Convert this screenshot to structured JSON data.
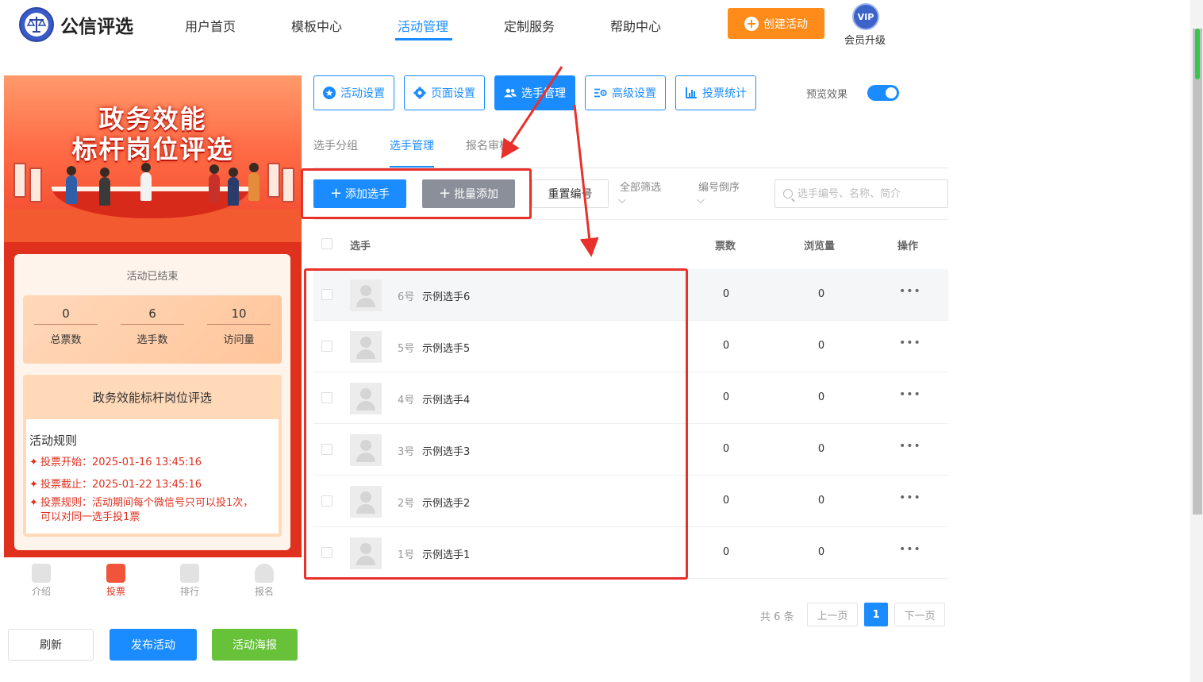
{
  "header": {
    "brand": "公信评选",
    "nav": [
      "用户首页",
      "模板中心",
      "活动管理",
      "定制服务",
      "帮助中心"
    ],
    "active_nav": "活动管理",
    "create_label": "创建活动",
    "vip_badge": "VIP",
    "vip_label": "会员升级"
  },
  "preview": {
    "banner_line1": "政务效能",
    "banner_line2": "标杆岗位评选",
    "status": "活动已结束",
    "stats": [
      {
        "value": "0",
        "label": "总票数"
      },
      {
        "value": "6",
        "label": "选手数"
      },
      {
        "value": "10",
        "label": "访问量"
      }
    ],
    "activity_title": "政务效能标杆岗位评选",
    "rules_heading": "活动规则",
    "rules": [
      "投票开始：2025-01-16 13:45:16",
      "投票截止：2025-01-22 13:45:16",
      "投票规则：活动期间每个微信号只可以投1次，可以对同一选手投1票"
    ],
    "tabs": [
      "介绍",
      "投票",
      "排行",
      "报名"
    ],
    "active_tab": "投票"
  },
  "actions": {
    "refresh": "刷新",
    "publish": "发布活动",
    "poster": "活动海报"
  },
  "toolbar": {
    "items": [
      "活动设置",
      "页面设置",
      "选手管理",
      "高级设置",
      "投票统计"
    ],
    "active": "选手管理",
    "preview_label": "预览效果",
    "preview_on": true
  },
  "subtabs": {
    "items": [
      "选手分组",
      "选手管理",
      "报名审核"
    ],
    "active": "选手管理"
  },
  "controls": {
    "add": "添加选手",
    "batch_add": "批量添加",
    "renumber": "重置编号",
    "filter_all": "全部筛选",
    "sort": "编号倒序",
    "search_placeholder": "选手编号、名称、简介"
  },
  "table": {
    "headers": {
      "player": "选手",
      "votes": "票数",
      "views": "浏览量",
      "ops": "操作"
    },
    "rows": [
      {
        "num": "6号",
        "name": "示例选手6",
        "votes": "0",
        "views": "0"
      },
      {
        "num": "5号",
        "name": "示例选手5",
        "votes": "0",
        "views": "0"
      },
      {
        "num": "4号",
        "name": "示例选手4",
        "votes": "0",
        "views": "0"
      },
      {
        "num": "3号",
        "name": "示例选手3",
        "votes": "0",
        "views": "0"
      },
      {
        "num": "2号",
        "name": "示例选手2",
        "votes": "0",
        "views": "0"
      },
      {
        "num": "1号",
        "name": "示例选手1",
        "votes": "0",
        "views": "0"
      }
    ],
    "more": "•••"
  },
  "pagination": {
    "total": "共 6 条",
    "prev": "上一页",
    "current": "1",
    "next": "下一页"
  },
  "colors": {
    "primary": "#1a8cff",
    "orange": "#ff8c1a",
    "green": "#67c23a",
    "banner_red": "#e0301e",
    "annotation_red": "#e8312a"
  }
}
